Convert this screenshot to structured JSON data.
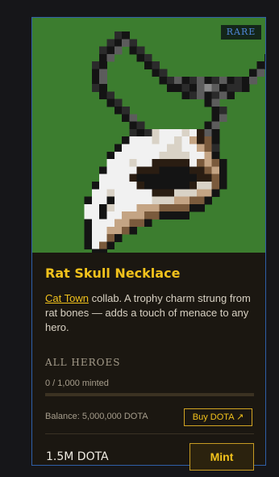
{
  "item": {
    "rarity": "RARE",
    "title": "Rat Skull Necklace",
    "description_link": "Cat Town",
    "description_rest": " collab. A trophy charm strung from rat bones — adds a touch of menace to any hero.",
    "hero_restriction": "ALL HEROES",
    "minted_text": "0 / 1,000 minted",
    "minted_fraction": 0,
    "balance_text": "Balance: 5,000,000 DOTA",
    "buy_label": "Buy DOTA ↗",
    "price": "1.5M DOTA",
    "mint_label": "Mint"
  },
  "colors": {
    "accent": "#f2c21c",
    "art_background": "#3c7d2f",
    "card_border": "#2f5fa8",
    "rarity_text": "#4f86d9"
  },
  "art_icon": "rat-skull-necklace-pixel-art"
}
